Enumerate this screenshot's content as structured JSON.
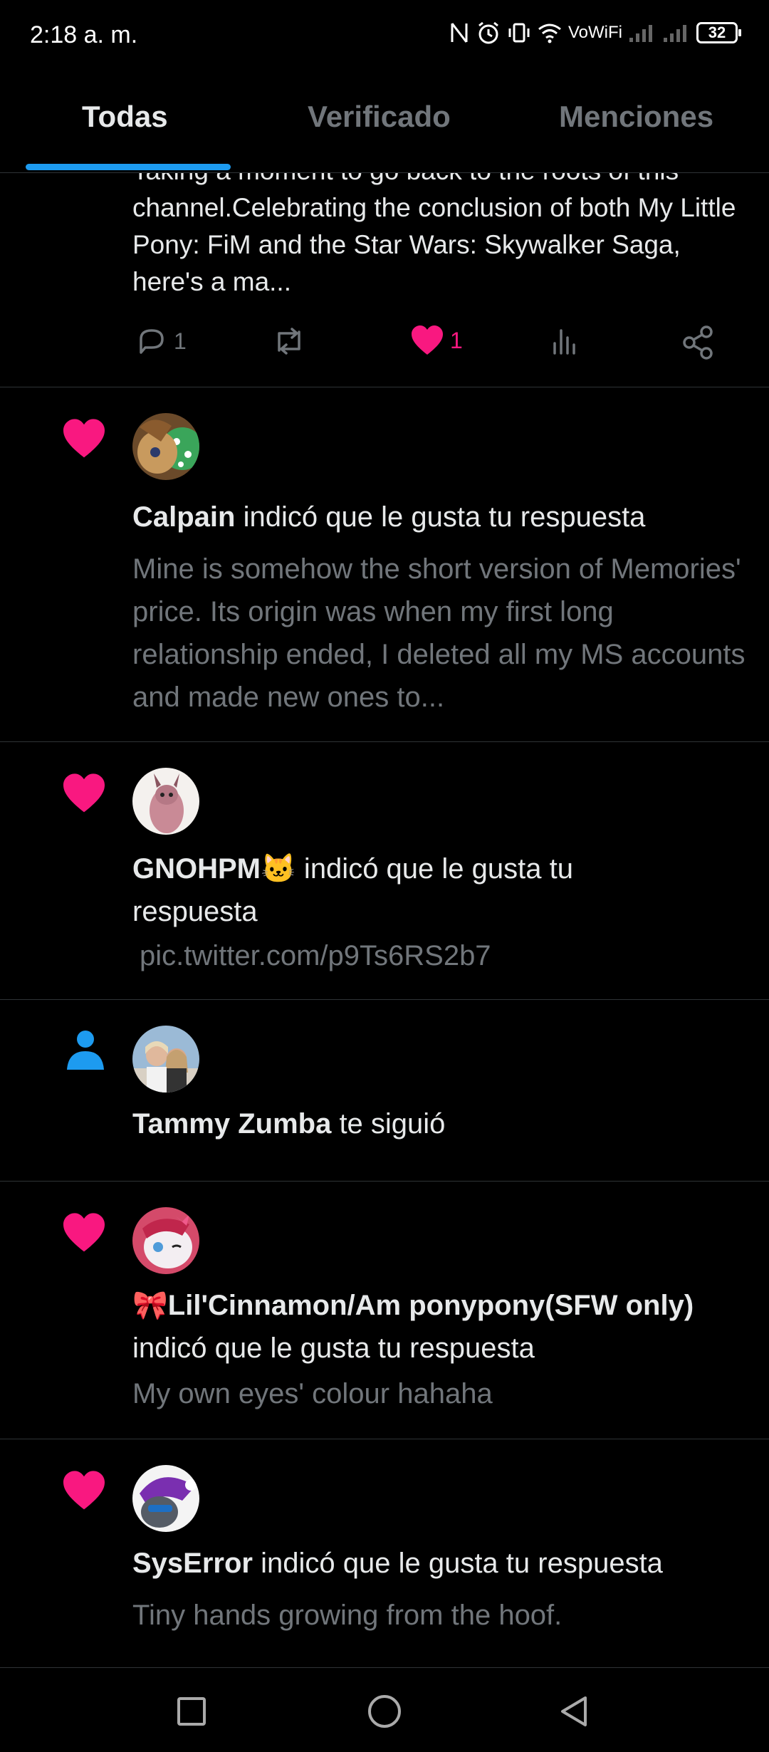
{
  "status_bar": {
    "time": "2:18 a. m.",
    "network": "VoWiFi",
    "battery": "32"
  },
  "tabs": [
    {
      "label": "Todas",
      "active": true
    },
    {
      "label": "Verificado",
      "active": false
    },
    {
      "label": "Menciones",
      "active": false
    }
  ],
  "partial_post": {
    "text": "Taking a moment to go back to the roots of this channel.Celebrating the conclusion of both My Little Pony: FiM and the Star Wars: Skywalker Saga, here's a ma...",
    "replies": "1",
    "likes": "1"
  },
  "notifications": [
    {
      "type": "like",
      "user": "Calpain",
      "action": " indicó que le gusta tu respuesta",
      "snippet": "Mine is somehow the short version of Memories' price. Its origin was when my first long relationship ended, I deleted all my MS accounts and made new ones to..."
    },
    {
      "type": "like",
      "user": "GNOHPM🐱",
      "action": " indicó que le gusta tu respuesta",
      "snippet": "pic.twitter.com/p9Ts6RS2b7"
    },
    {
      "type": "follow",
      "user": "Tammy Zumba",
      "action": " te siguió"
    },
    {
      "type": "like",
      "user": "🎀Lil'Cinnamon/Am ponypony(SFW only)",
      "action": " indicó que le gusta tu respuesta",
      "snippet": "My own eyes' colour hahaha"
    },
    {
      "type": "like",
      "user": "SysError",
      "action": " indicó que le gusta tu respuesta",
      "snippet": "Tiny hands growing from the hoof."
    }
  ],
  "colors": {
    "like": "#f91880",
    "accent": "#1d9bf0",
    "secondary_text": "#71767b",
    "divider": "#2f3336"
  },
  "nav": {
    "icons": [
      "recents-icon",
      "home-icon",
      "back-icon"
    ]
  }
}
